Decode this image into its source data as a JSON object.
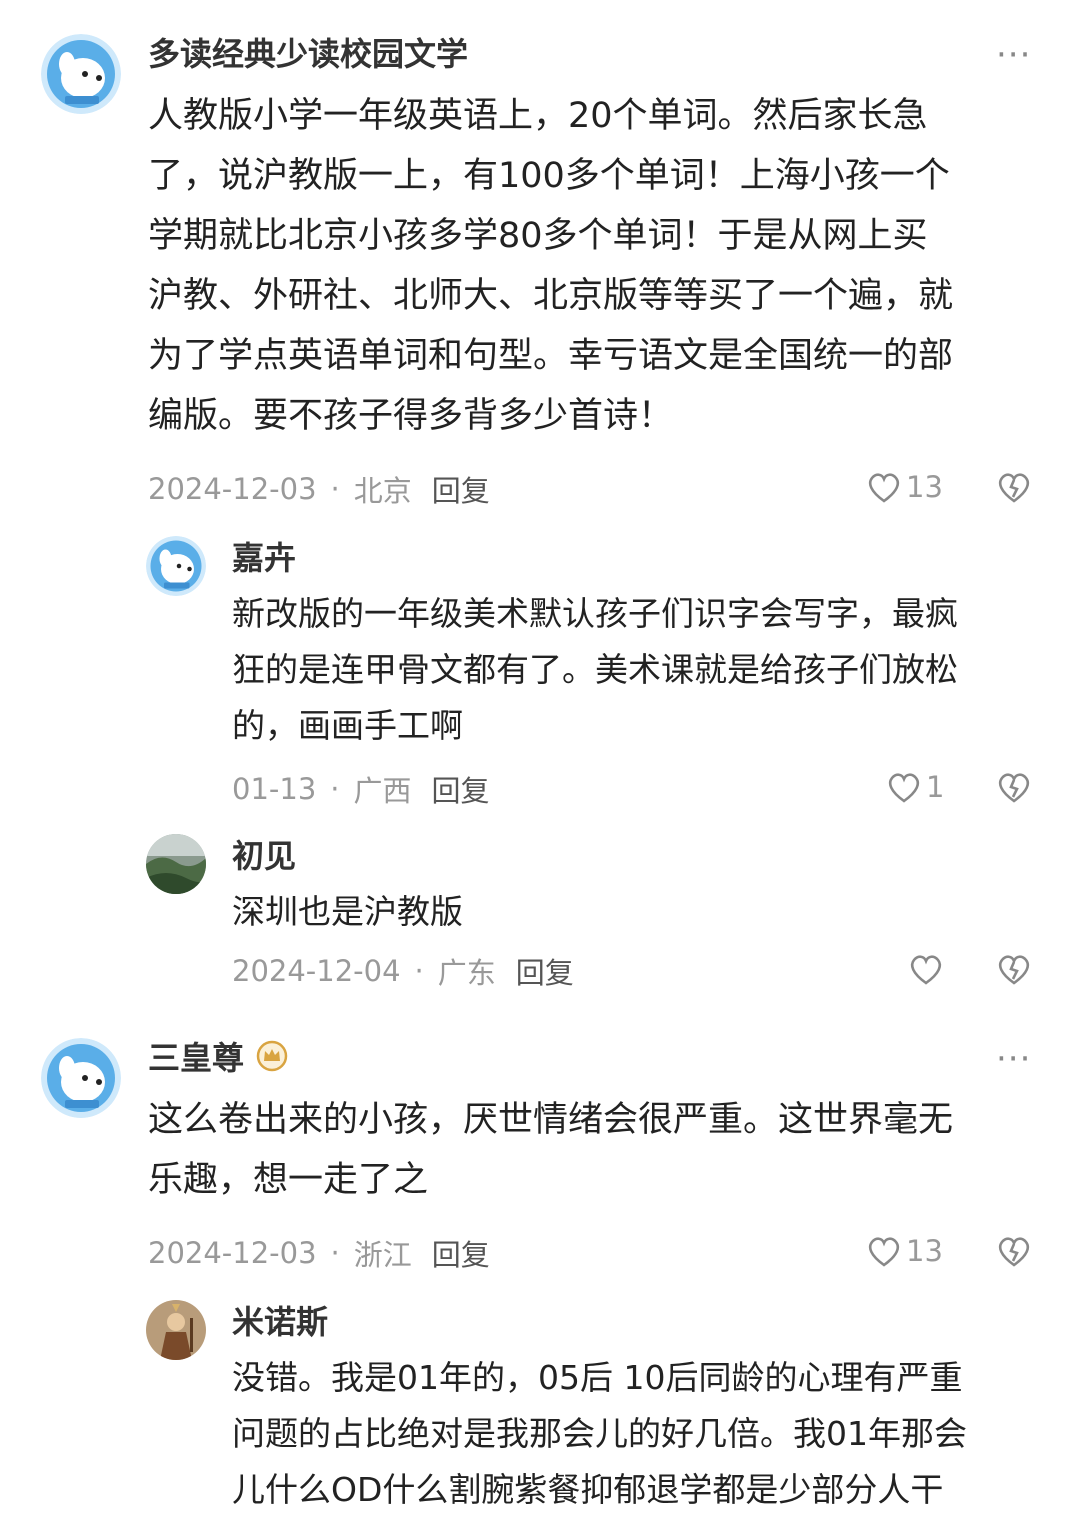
{
  "comments": [
    {
      "username": "多读经典少读校园文学",
      "body_lines": [
        "人教版小学一年级英语上，20个单词。然后家长急",
        "了，说沪教版一上，有100多个单词！上海小孩一个",
        "学期就比北京小孩多学80多个单词！于是从网上买",
        "沪教、外研社、北师大、北京版等等买了一个遍，就",
        "为了学点英语单词和句型。幸亏语文是全国统一的部",
        "编版。要不孩子得多背多少首诗！"
      ],
      "date": "2024-12-03",
      "location": "北京",
      "reply_label": "回复",
      "likes": "13",
      "more_icon": "more-dots-icon"
    },
    {
      "username": "嘉卉",
      "body_lines": [
        "新改版的一年级美术默认孩子们识字会写字，最疯",
        "狂的是连甲骨文都有了。美术课就是给孩子们放松",
        "的，画画手工啊"
      ],
      "date": "01-13",
      "location": "广西",
      "reply_label": "回复",
      "likes": "1"
    },
    {
      "username": "初见",
      "body_lines": [
        "深圳也是沪教版"
      ],
      "date": "2024-12-04",
      "location": "广东",
      "reply_label": "回复",
      "likes": ""
    },
    {
      "username": "三皇尊",
      "badge_icon": "crown-badge-icon",
      "body_lines": [
        "这么卷出来的小孩，厌世情绪会很严重。这世界毫无",
        "乐趣，想一走了之"
      ],
      "date": "2024-12-03",
      "location": "浙江",
      "reply_label": "回复",
      "likes": "13",
      "more_icon": "more-dots-icon"
    },
    {
      "username": "米诺斯",
      "body_lines": [
        "没错。我是01年的，05后 10后同龄的心理有严重",
        "问题的占比绝对是我那会儿的好几倍。我01年那会",
        "儿什么OD什么割腕紫餐抑郁退学都是少部分人干"
      ]
    }
  ],
  "colors": {
    "meta": "#999999",
    "text": "#222222",
    "avatar_blue": "#5aaee8",
    "badge_gold": "#d9a441"
  }
}
